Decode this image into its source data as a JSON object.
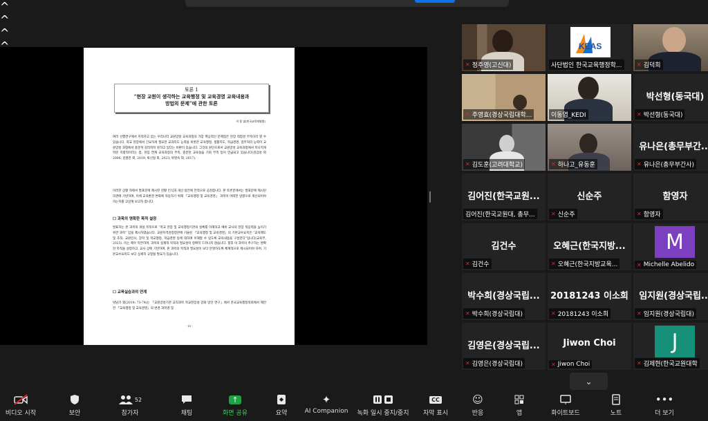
{
  "document": {
    "heading": "토론 1",
    "title_line1": "“현장 교원이 생각하는 교육행정 및 교육경영 교육내용과",
    "title_line2": "방법의 문제”에 관한 토론",
    "author": "이 동 엽(한국교육개발원)",
    "para1": "여러 선행연구에서 지적하고 있는 우리나라 교원양성 교육과정의 가장 핵심적인 문제점은 현장 적합성 부족이라 할 수 있습니다. 학교 현장에서 긴요하게 필요한 교과지도 능력을 비롯한 교육행정, 생활지도, 학급경영, 업무처리 능력이 교원양성 과정에서 충분히 길러지지 못하고 있다는 비판이 있습니다. 그것의 원인으로서 교원양성 교육과정에서 지나치게 학문 지향적이라는 점, 현장 연계 교육과정의 부족, 충분한 교육실습 기회 부족 등이 언급되고 있습니다(김갑성 외 2006; 김병찬 외, 2019; 박선형 외, 2023; 박영숙 외, 2017).",
    "para2": "이러한 상황 하에서 발표문에 제시된 현황 인식과 개선 방안에 전적으로 공감합니다. 본 토론문에서는 발표문에 제시된 의견에 기반하여, 이에 교육환경 변화에 적응하기 위해 「교육행정 및 교육경영」 과목이 어떠한 방향으로 개선되어야 하는지를 고민해 보고자 합니다.",
    "section1": "☐ 과목의 명확한 목적 설정",
    "para3": "발표자는 본 과목의 개설 목적으로 “학교 현장 및 교육행정기관의 실체를 이해하고 예비 교사의 현장 적응력을 높이기 위한 과목” 임을 제시하였습니다. 교원자격검정령관에 기술된 「교육행정 및 교육경영」의 기본교수요목은 “교육제도 및 조직, 교원인사, 장학 및 학교행정, 학급경영 등에 대하여 이해할 수 있도록 교육내용을 구성한다”입니다(교육부, 2023). 이는 매우 막연하며, 과목의 실제적 목적과 필요성이 정확히 드러나지 않습니다. 향후 이 과목이 추구하는 명확한 목적을 설정하고, 교사 상에 기반하여, 본 과목의 목적과 필요성이 보다 분명하도록 체계적으로 제시되어야 하며, 기본교수요목도 보다 상세히 규정될 필요가 있습니다.",
    "section2": "☐ 교육실습과의 연계",
    "para4": "박남기 외(2019: 73-74)는 「교원양성기관 교직과목 학교현장성 강화 방안 연구」에서 한국교육행정학회에서 제안한 「교육행정 및 교육경영」의 변경 과목명 및",
    "page_number": "- 15 -"
  },
  "participants": [
    {
      "display": "",
      "label": "정주영(고신대)",
      "muted": true,
      "video": true
    },
    {
      "display": "",
      "label": "사단법인 한국교육행정학...",
      "muted": false,
      "video": true,
      "logo_text": "KEAS"
    },
    {
      "display": "",
      "label": "김덕희",
      "muted": true,
      "video": true
    },
    {
      "display": "",
      "label": "주영효(경상국립대학...",
      "muted": true,
      "video": true
    },
    {
      "display": "",
      "label": "이동엽_KEDI",
      "muted": false,
      "video": true,
      "active": true
    },
    {
      "display": "박선형(동국대)",
      "label": "박선형(동국대)",
      "muted": true,
      "video": false
    },
    {
      "display": "",
      "label": "김도훈(고려대학교)",
      "muted": true,
      "video": true
    },
    {
      "display": "",
      "label": "하나고_유동훈",
      "muted": true,
      "video": true
    },
    {
      "display": "유나은(총무부간...",
      "label": "유나은(총무부간사)",
      "muted": true,
      "video": false
    },
    {
      "display": "김어진(한국교원...",
      "label": "김어진(한국교원대, 총무...",
      "muted": false,
      "video": false
    },
    {
      "display": "신순주",
      "label": "신순주",
      "muted": true,
      "video": false
    },
    {
      "display": "함영자",
      "label": "함영자",
      "muted": true,
      "video": false
    },
    {
      "display": "김건수",
      "label": "김건수",
      "muted": true,
      "video": false
    },
    {
      "display": "오혜근(한국지방...",
      "label": "오혜근(한국지방교육...",
      "muted": true,
      "video": false
    },
    {
      "display": "M",
      "label": "Michelle Abelido",
      "muted": true,
      "video": false,
      "avatar_color": "#7b3fbf"
    },
    {
      "display": "박수희(경상국립...",
      "label": "박수희(경상국립대)",
      "muted": true,
      "video": false
    },
    {
      "display": "20181243 이소희",
      "label": "20181243 이소희",
      "muted": true,
      "video": false
    },
    {
      "display": "임지원(경상국립...",
      "label": "임지원(경상국립대)",
      "muted": true,
      "video": false
    },
    {
      "display": "김영은(경상국립...",
      "label": "김영은(경상국립대)",
      "muted": true,
      "video": false
    },
    {
      "display": "Jiwon Choi",
      "label": "Jiwon Choi",
      "muted": true,
      "video": false
    },
    {
      "display": "J",
      "label": "김제현(한국교원대학",
      "muted": true,
      "video": false,
      "avatar_color": "#17907a"
    }
  ],
  "more_chevron": "⌄",
  "toolbar": {
    "video": "비디오 시작",
    "security": "보안",
    "participants": "참가자",
    "participants_count": "52",
    "chat": "채팅",
    "share": "화면 공유",
    "summary": "요약",
    "ai": "AI Companion",
    "record": "녹화 일시 중지/중지",
    "captions": "자막 표시",
    "reactions": "반응",
    "apps": "앱",
    "whiteboard": "화이트보드",
    "notes": "노트",
    "more": "더 보기",
    "caret": "^"
  }
}
